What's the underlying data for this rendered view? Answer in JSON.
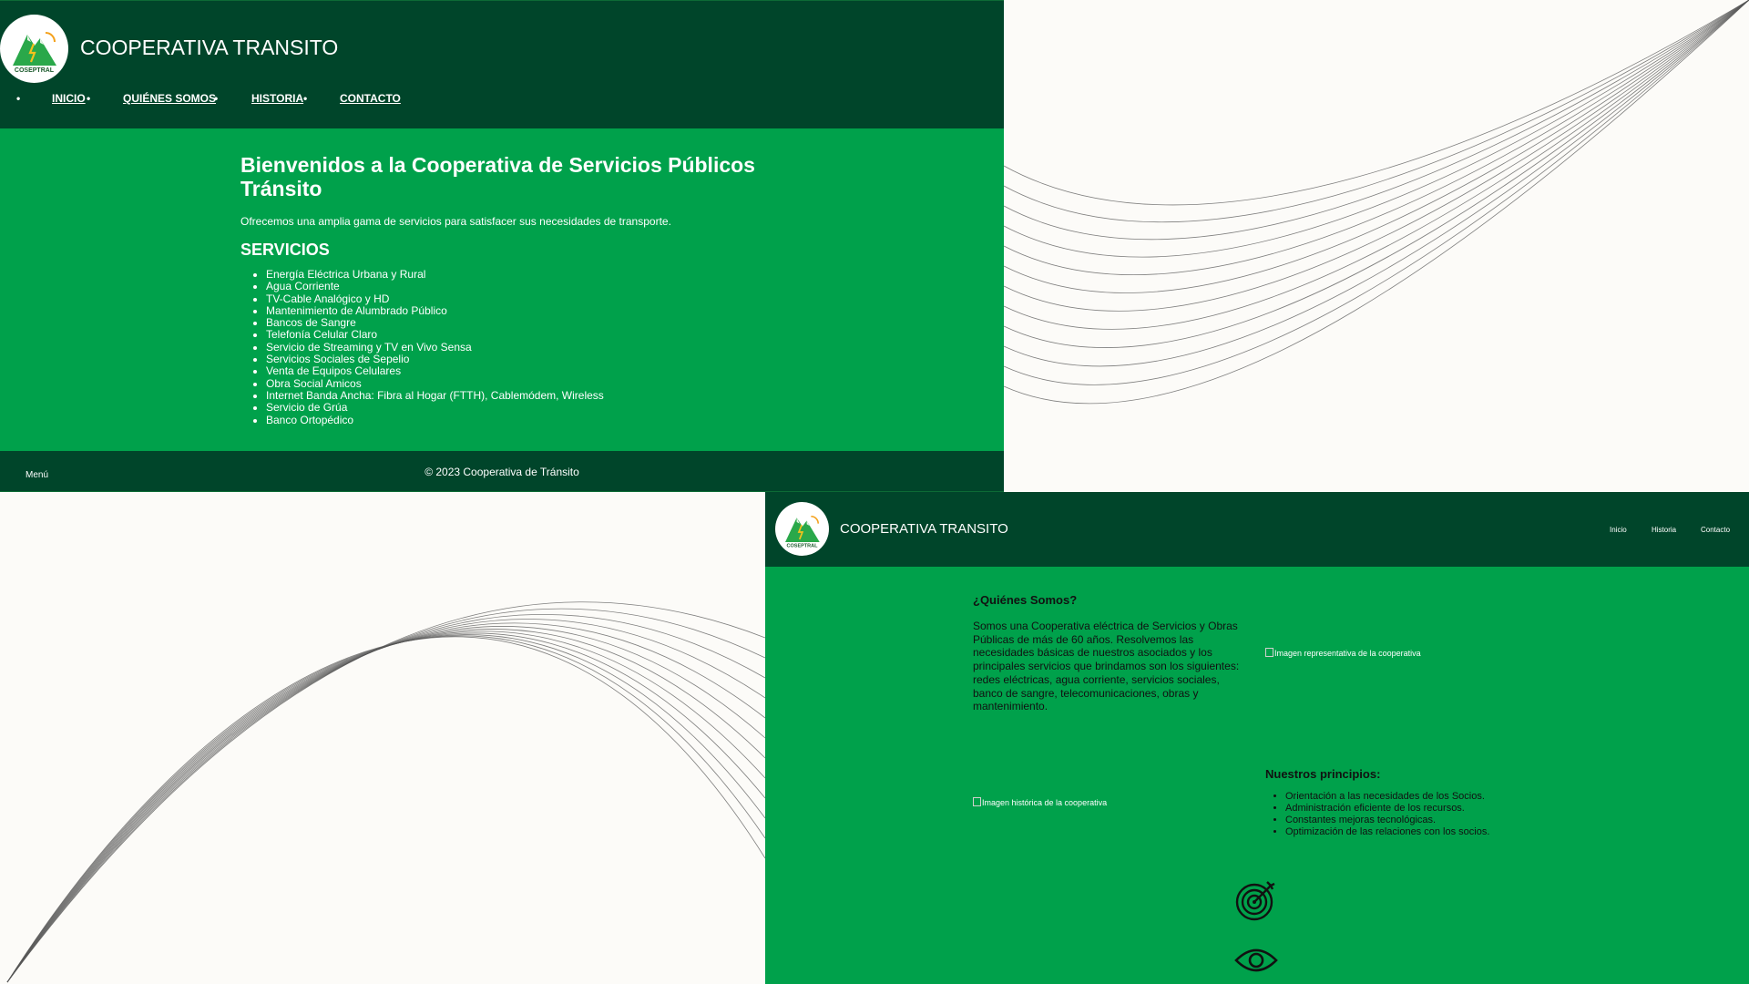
{
  "colors": {
    "dark_green": "#00452a",
    "bright_green": "#00a14b",
    "background": "#fcfbf8",
    "text_white": "#ffffff",
    "text_dark": "#111111"
  },
  "home": {
    "header": {
      "logo_text": "COSEPTRAL",
      "title": "COOPERATIVA TRANSITO"
    },
    "nav": [
      {
        "label": "INICIO"
      },
      {
        "label": "QUIÉNES SOMOS"
      },
      {
        "label": "HISTORIA"
      },
      {
        "label": "CONTACTO"
      }
    ],
    "main": {
      "heading": "Bienvenidos a la Cooperativa de Servicios Públicos Tránsito",
      "intro": "Ofrecemos una amplia gama de servicios para satisfacer sus necesidades de transporte.",
      "services_heading": "SERVICIOS",
      "services": [
        "Energía Eléctrica Urbana y Rural",
        "Agua Corriente",
        "TV-Cable Analógico y HD",
        "Mantenimiento de Alumbrado Público",
        "Bancos de Sangre",
        "Telefonía Celular Claro",
        "Servicio de Streaming y TV en Vivo Sensa",
        "Servicios Sociales de Sepelio",
        "Venta de Equipos Celulares",
        "Obra Social Amicos",
        "Internet Banda Ancha: Fibra al Hogar (FTTH), Cablemódem, Wireless",
        "Servicio de Grúa",
        "Banco Ortopédico"
      ]
    },
    "footer": {
      "menu_label": "Menú",
      "copyright": "© 2023 Cooperativa de Tránsito"
    }
  },
  "about": {
    "header": {
      "logo_text": "COSEPTRAL",
      "title": "COOPERATIVA TRANSITO"
    },
    "nav": [
      {
        "label": "Inicio"
      },
      {
        "label": "Historia"
      },
      {
        "label": "Contacto"
      }
    ],
    "quienes_heading": "¿Quiénes Somos?",
    "quienes_text": "Somos una Cooperativa eléctrica de Servicios y Obras Públicas de más de 60 años. Resolvemos las necesidades básicas de nuestros asociados y los principales servicios que brindamos son los siguientes: redes eléctricas, agua corriente, servicios sociales, banco de sangre, telecomunicaciones, obras y mantenimiento.",
    "image1_alt": "Imagen representativa de la cooperativa",
    "image2_alt": "Imagen histórica de la cooperativa",
    "principios_heading": "Nuestros principios:",
    "principios": [
      "Orientación a las necesidades de los Socios.",
      "Administración eficiente de los recursos.",
      "Constantes mejoras tecnológicas.",
      "Optimización de las relaciones con los socios."
    ],
    "icons": [
      "target-icon",
      "eye-icon"
    ]
  }
}
